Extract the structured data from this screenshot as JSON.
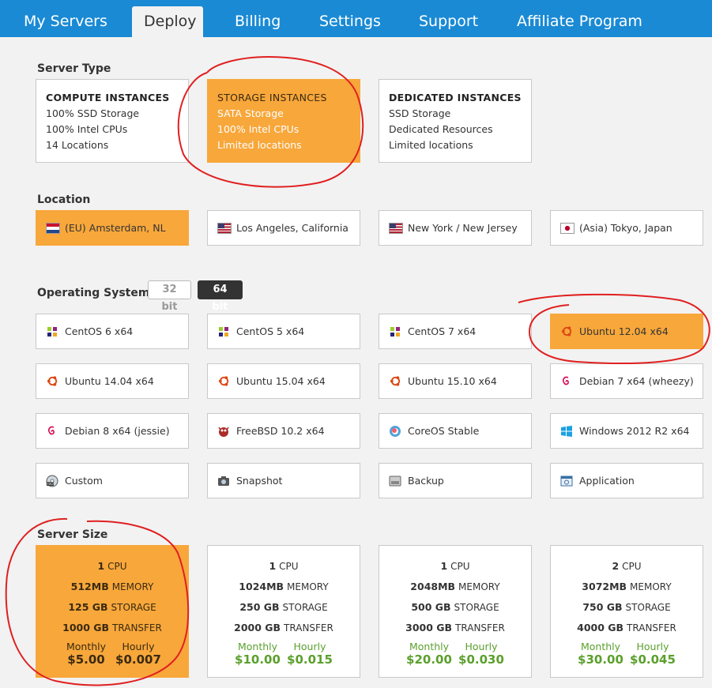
{
  "nav": {
    "tabs": [
      "My Servers",
      "Deploy",
      "Billing",
      "Settings",
      "Support",
      "Affiliate Program"
    ],
    "active": "Deploy"
  },
  "server_type": {
    "title": "Server Type",
    "cards": [
      {
        "name": "COMPUTE INSTANCES",
        "lines": [
          "100% SSD Storage",
          "100% Intel CPUs",
          "14 Locations"
        ]
      },
      {
        "name": "STORAGE INSTANCES",
        "lines": [
          "SATA Storage",
          "100% Intel CPUs",
          "Limited locations"
        ]
      },
      {
        "name": "DEDICATED INSTANCES",
        "lines": [
          "SSD Storage",
          "Dedicated Resources",
          "Limited locations"
        ]
      }
    ]
  },
  "location": {
    "title": "Location",
    "options": [
      "(EU) Amsterdam, NL",
      "Los Angeles, California",
      "New York / New Jersey",
      "(Asia) Tokyo, Japan"
    ]
  },
  "os": {
    "title": "Operating System",
    "bit32": "32 bit",
    "bit64": "64 bit",
    "options": [
      "CentOS 6 x64",
      "CentOS 5 x64",
      "CentOS 7 x64",
      "Ubuntu 12.04 x64",
      "Ubuntu 14.04 x64",
      "Ubuntu 15.04 x64",
      "Ubuntu 15.10 x64",
      "Debian 7 x64 (wheezy)",
      "Debian 8 x64 (jessie)",
      "FreeBSD 10.2 x64",
      "CoreOS Stable",
      "Windows 2012 R2 x64",
      "Custom",
      "Snapshot",
      "Backup",
      "Application"
    ]
  },
  "size": {
    "title": "Server Size",
    "labels": {
      "cpu": "CPU",
      "memory": "MEMORY",
      "storage": "STORAGE",
      "transfer": "TRANSFER",
      "monthly": "Monthly",
      "hourly": "Hourly"
    },
    "plans": [
      {
        "cpu": "1",
        "memory": "512MB",
        "storage": "125 GB",
        "transfer": "1000 GB",
        "monthly": "$5.00",
        "hourly": "$0.007"
      },
      {
        "cpu": "1",
        "memory": "1024MB",
        "storage": "250 GB",
        "transfer": "2000 GB",
        "monthly": "$10.00",
        "hourly": "$0.015"
      },
      {
        "cpu": "1",
        "memory": "2048MB",
        "storage": "500 GB",
        "transfer": "3000 GB",
        "monthly": "$20.00",
        "hourly": "$0.030"
      },
      {
        "cpu": "2",
        "memory": "3072MB",
        "storage": "750 GB",
        "transfer": "4000 GB",
        "monthly": "$30.00",
        "hourly": "$0.045"
      }
    ]
  },
  "colors": {
    "nav": "#1a8ad4",
    "selected": "#f8a73b",
    "price": "#5aa02c",
    "annotation": "#e02020"
  },
  "icons": {
    "flags": [
      "flag-nl",
      "flag-us",
      "flag-us",
      "flag-jp"
    ],
    "os": [
      "centos-icon",
      "centos-icon",
      "centos-icon",
      "ubuntu-icon",
      "ubuntu-icon",
      "ubuntu-icon",
      "ubuntu-icon",
      "debian-icon",
      "debian-icon",
      "freebsd-icon",
      "coreos-icon",
      "windows-icon",
      "iso-icon",
      "camera-icon",
      "backup-icon",
      "application-icon"
    ]
  }
}
